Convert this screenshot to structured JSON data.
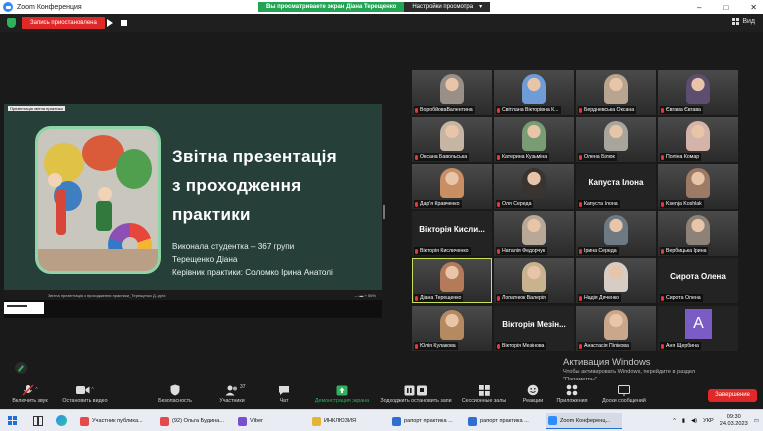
{
  "window": {
    "title": "Zoom Конференция",
    "share_banner": "Вы просматриваете экран Діана Терещенко",
    "view_options": "Настройки просмотра",
    "controls": [
      "–",
      "□",
      "✕"
    ]
  },
  "topstrip": {
    "recording_label": "Запись приостановлена",
    "view_label": "Вид"
  },
  "slide": {
    "mini_label": "Презентація звітна практика",
    "title_lines": [
      "Звітна презентація",
      "з проходження",
      "практики"
    ],
    "sub_lines": [
      "Виконала студентка – 367 групи",
      "Терещенко Діана",
      "Керівник практики: Соломко Ірина Анатолі"
    ],
    "file_label": "Звітна презентація з проходження практики_Терещенко Д..pptx",
    "zoom_label": "— ▬ + 56%"
  },
  "gallery": {
    "tiles": [
      {
        "name": "ВоробйоваВалентина",
        "kind": "video",
        "color": "#9a8f86"
      },
      {
        "name": "Світлана Вікторівна К...",
        "kind": "video",
        "color": "#6f9bd6"
      },
      {
        "name": "Бердневська Оксана",
        "kind": "video",
        "color": "#b9a58f"
      },
      {
        "name": "Євгава Євгава",
        "kind": "video",
        "color": "#5d4d6e"
      },
      {
        "name": "Оксана Бавольська",
        "kind": "video",
        "color": "#c7b5a4"
      },
      {
        "name": "Катерина Кузьміна",
        "kind": "video",
        "color": "#7a9c74"
      },
      {
        "name": "Олена Білюк",
        "kind": "video",
        "color": "#a8a59c"
      },
      {
        "name": "Поліна Комар",
        "kind": "video",
        "color": "#d4b3a8"
      },
      {
        "name": "Дар'я Кравченко",
        "kind": "video",
        "color": "#c98e62"
      },
      {
        "name": "Оля Середа",
        "kind": "video",
        "color": "#3a3431"
      },
      {
        "name": "Капуста Ілона",
        "kind": "text",
        "display": "Капуста Ілона"
      },
      {
        "name": "Ksenja Koshlak",
        "kind": "video",
        "color": "#9c7a66"
      },
      {
        "name": "Вікторія Кисличенко",
        "kind": "text",
        "display": "Вікторія Кисли..."
      },
      {
        "name": "Наталія Федорчук",
        "kind": "video",
        "color": "#b9a897"
      },
      {
        "name": "Ірина Середа",
        "kind": "video",
        "color": "#6e7a83"
      },
      {
        "name": "Вербицька Ірина",
        "kind": "video",
        "color": "#8c8278"
      },
      {
        "name": "Діана Терещенко",
        "kind": "video",
        "color": "#b57a5a",
        "active": true
      },
      {
        "name": "Лопатнюк Валерія",
        "kind": "video",
        "color": "#c9b38f"
      },
      {
        "name": "Надія Дяченко",
        "kind": "video",
        "color": "#d8cdc4"
      },
      {
        "name": "Сирота Олена",
        "kind": "text",
        "display": "Сирота Олена"
      },
      {
        "name": "Юлія Кулакова",
        "kind": "video",
        "color": "#b68a60"
      },
      {
        "name": "Вікторія Мезінова",
        "kind": "text",
        "display": "Вікторія Мезін..."
      },
      {
        "name": "Анастасія Пілікова",
        "kind": "video",
        "color": "#caa78b"
      },
      {
        "name": "Аня Щербина",
        "kind": "avatar",
        "letter": "A"
      }
    ]
  },
  "activation": {
    "title": "Активация Windows",
    "line1": "Чтобы активировать Windows, перейдите в раздел",
    "line2": "\"Параметры\"."
  },
  "toolbar": {
    "mute": "Включить звук",
    "video": "Остановить видео",
    "security": "Безопасность",
    "participants": "Участники",
    "participants_count": "37",
    "chat": "Чат",
    "share": "Демонстрация экрана",
    "pause_share": "Зодходжить остановить запи",
    "rooms": "Сессионные залы",
    "reactions": "Реакции",
    "apps": "Приложения",
    "whiteboard": "Доски сообщений",
    "end": "Завершение"
  },
  "taskbar": {
    "apps": [
      {
        "label": "Участник публика...",
        "color": "#e34b4b"
      },
      {
        "label": "(92) Ольга Будина...",
        "color": "#e34b4b"
      },
      {
        "label": "Viber",
        "color": "#7a4fcf"
      },
      {
        "label": "ИНКЛЮЗИЯ",
        "color": "#e2b437"
      },
      {
        "label": "рапорт практика ...",
        "color": "#2f6fd1"
      },
      {
        "label": "рапорт практика ...",
        "color": "#2f6fd1"
      },
      {
        "label": "Zoom Конференц...",
        "color": "#2d8cff",
        "active": true
      }
    ],
    "lang": "УКР",
    "time": "09:30",
    "date": "24.03.2023"
  },
  "colors": {
    "zoom_blue": "#2d8cff",
    "rec_red": "#e02828",
    "share_green": "#23a455",
    "slide_bg": "#263f38",
    "active_speaker": "#c9e05a"
  }
}
